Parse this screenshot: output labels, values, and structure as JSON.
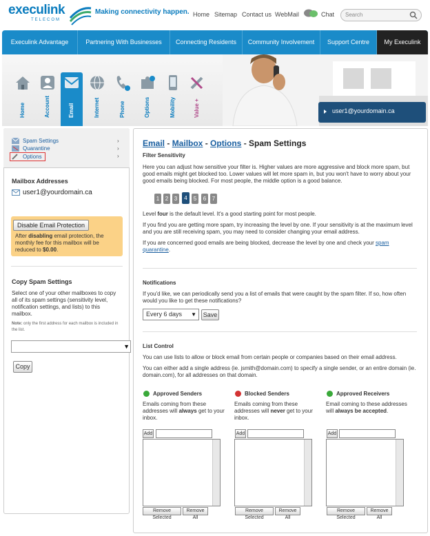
{
  "header": {
    "logo": "execulink",
    "logo_sub": "TELECOM",
    "tagline": "Making connectivity happen.",
    "links": [
      "Home",
      "Sitemap",
      "Contact us",
      "WebMail",
      "Chat"
    ],
    "search_placeholder": "Search"
  },
  "nav": [
    "Execulink Advantage",
    "Partnering With Businesses",
    "Connecting Residents",
    "Community Involvement",
    "Support Centre",
    "My Execulink"
  ],
  "icon_tabs": [
    "Home",
    "Account",
    "Email",
    "Internet",
    "Phone",
    "Options",
    "Mobility",
    "Value +"
  ],
  "user_email": "user1@yourdomain.ca",
  "sidebar": {
    "links": [
      "Spam Settings",
      "Quarantine",
      "Options"
    ],
    "mailbox_title": "Mailbox Addresses",
    "mailbox_address": "user1@yourdomain.ca",
    "disable_button": "Disable Email Protection",
    "disable_note_1": "After ",
    "disable_note_bold": "disabling",
    "disable_note_2": " email protection, the monthly fee for this mailbox will be reduced to ",
    "disable_note_price": "$0.00",
    "disable_note_end": ".",
    "copy_title": "Copy Spam Settings",
    "copy_text": "Select one of your other mailboxes to copy all of its spam settings (sensitivity level, notification settings, and lists) to this mailbox.",
    "note_label": "Note:",
    "note_text": " only the first address for each mailbox is included in the list.",
    "copy_button": "Copy"
  },
  "main": {
    "crumb_email": "Email",
    "crumb_mailbox": "Mailbox",
    "crumb_options": "Options",
    "crumb_sep": " - ",
    "crumb_current": "Spam Settings",
    "filter_title": "Filter Sensitivity",
    "filter_desc": "Here you can adjust how sensitive your filter is. Higher values are more aggressive and block more spam, but good emails might get blocked too. Lower values will let more spam in, but you won't have to worry about your good emails being blocked. For most people, the middle option is a good balance.",
    "levels": [
      "1",
      "2",
      "3",
      "4",
      "5",
      "6",
      "7"
    ],
    "selected_level": 4,
    "level_text_1": "Level ",
    "level_text_bold": "four",
    "level_text_2": " is the default level. It's a good starting point for most people.",
    "more_spam": "If you find you are getting more spam, try increasing the level by one. If your sensitivity is at the maximum level and you are still receiving spam, you may need to consider changing your email address.",
    "blocked_1": "If you are concerned good emails are being blocked, decrease the level by one and check your ",
    "blocked_link": "spam quarantine",
    "blocked_end": ".",
    "notif_title": "Notifications",
    "notif_text": "If you'd like, we can periodically send you a list of emails that were caught by the spam filter. If so, how often would you like to get these notifications?",
    "notif_value": "Every 6 days",
    "save": "Save",
    "list_title": "List Control",
    "list_text1": "You can use lists to allow or block email from certain people or companies based on their email address.",
    "list_text2": "You can either add a single address (ie. jsmith@domain.com) to specify a single sender, or an entire domain (ie. domain.com), for all addresses on that domain.",
    "lists": [
      {
        "title": "Approved Senders",
        "desc_1": "Emails coming from these addresses will ",
        "desc_bold": "always",
        "desc_2": " get to your inbox.",
        "color": "#3aa93a"
      },
      {
        "title": "Blocked Senders",
        "desc_1": "Emails coming from these addresses will ",
        "desc_bold": "never",
        "desc_2": " get to your inbox.",
        "color": "#d33333"
      },
      {
        "title": "Approved Receivers",
        "desc_1": "Email coming to these addresses will ",
        "desc_bold": "always be accepted",
        "desc_2": ".",
        "color": "#3aa93a"
      }
    ],
    "add": "Add",
    "remove_selected": "Remove Selected",
    "remove_all": "Remove All"
  }
}
